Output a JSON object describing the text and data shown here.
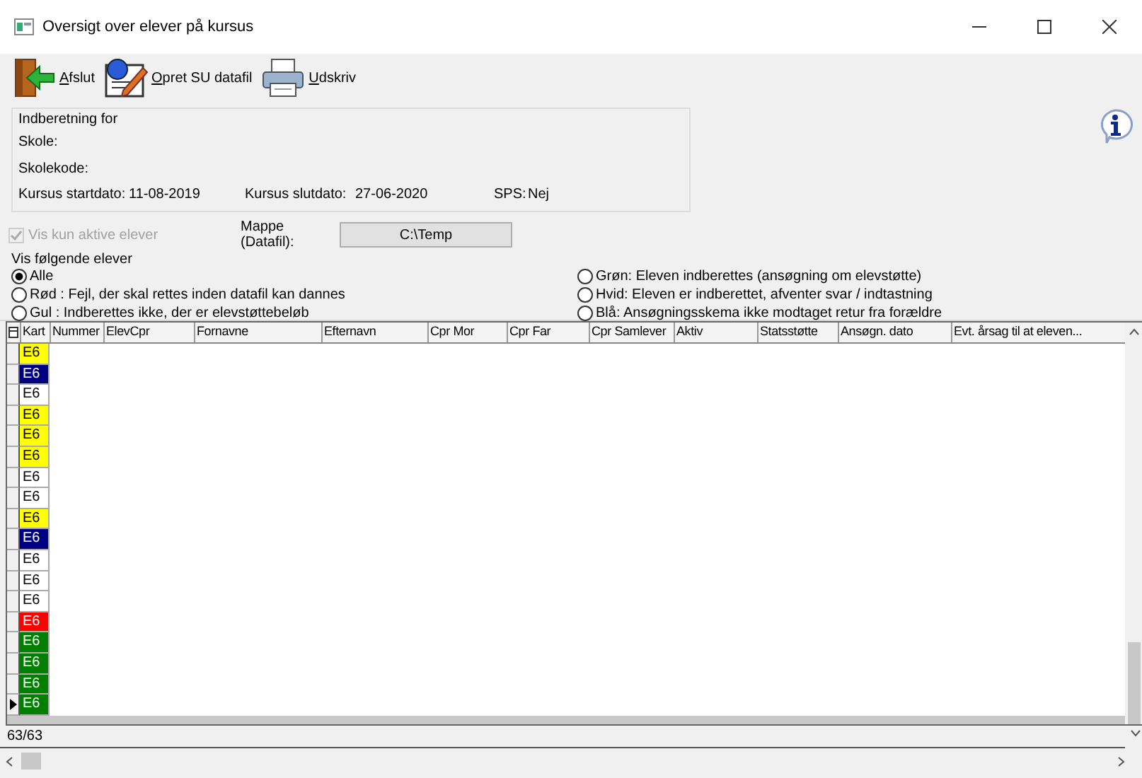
{
  "window": {
    "title": "Oversigt over elever på kursus"
  },
  "toolbar": [
    {
      "kind": "exit",
      "label": "Afslut",
      "access_key_underlined": true
    },
    {
      "kind": "datafile",
      "label": "Opret SU datafil",
      "access_key_underlined": true
    },
    {
      "kind": "print",
      "label": "Udskriv",
      "access_key_underlined": true
    }
  ],
  "report_group": {
    "legend": "Indberetning for",
    "school_label": "Skole:",
    "school_code_label": "Skolekode:",
    "start_label": "Kursus startdato:",
    "start_value": "11-08-2019",
    "end_label": "Kursus slutdato:",
    "end_value": "27-06-2020",
    "sps_label": "SPS:",
    "sps_value": "Nej"
  },
  "active_only": {
    "label": "Vis kun aktive elever",
    "checked": true,
    "disabled": true
  },
  "folder": {
    "label": "Mappe (Datafil):",
    "value": "C:\\Temp"
  },
  "filter": {
    "legend": "Vis følgende elever",
    "options": [
      {
        "label": "Alle",
        "selected": true
      },
      {
        "label": "Rød : Fejl, der skal rettes inden datafil kan dannes",
        "selected": false
      },
      {
        "label": "Gul : Indberettes ikke, der er elevstøttebeløb",
        "selected": false
      },
      {
        "label": "Grøn: Eleven indberettes (ansøgning om elevstøtte)",
        "selected": false
      },
      {
        "label": "Hvid: Eleven er indberettet, afventer svar / indtastning",
        "selected": false
      },
      {
        "label": "Blå: Ansøgningsskema ikke modtaget retur fra forældre",
        "selected": false
      }
    ]
  },
  "table": {
    "columns": [
      "Kart",
      "Nummer",
      "ElevCpr",
      "Fornavne",
      "Efternavn",
      "Cpr Mor",
      "Cpr Far",
      "Cpr Samlever",
      "Aktiv",
      "Statsstøtte",
      "Ansøgn. dato",
      "Evt. årsag til at eleven..."
    ],
    "rows": [
      {
        "kart": "E6",
        "color": "#ffff00",
        "current": false
      },
      {
        "kart": "E6",
        "color": "#000080",
        "current": false
      },
      {
        "kart": "E6",
        "color": "#ffffff",
        "current": false
      },
      {
        "kart": "E6",
        "color": "#ffff00",
        "current": false
      },
      {
        "kart": "E6",
        "color": "#ffff00",
        "current": false
      },
      {
        "kart": "E6",
        "color": "#ffff00",
        "current": false
      },
      {
        "kart": "E6",
        "color": "#ffffff",
        "current": false
      },
      {
        "kart": "E6",
        "color": "#ffffff",
        "current": false
      },
      {
        "kart": "E6",
        "color": "#ffff00",
        "current": false
      },
      {
        "kart": "E6",
        "color": "#000080",
        "current": false
      },
      {
        "kart": "E6",
        "color": "#ffffff",
        "current": false
      },
      {
        "kart": "E6",
        "color": "#ffffff",
        "current": false
      },
      {
        "kart": "E6",
        "color": "#ffffff",
        "current": false
      },
      {
        "kart": "E6",
        "color": "#ff0000",
        "current": false
      },
      {
        "kart": "E6",
        "color": "#008000",
        "current": false
      },
      {
        "kart": "E6",
        "color": "#008000",
        "current": false
      },
      {
        "kart": "E6",
        "color": "#008000",
        "current": false
      },
      {
        "kart": "E6",
        "color": "#008000",
        "current": true
      }
    ]
  },
  "status_bar": {
    "count": "63/63"
  }
}
